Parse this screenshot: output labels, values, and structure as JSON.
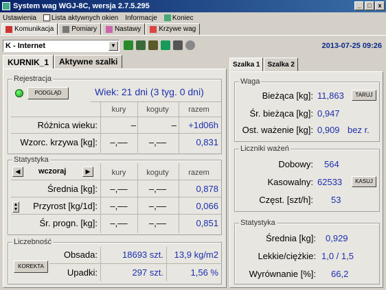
{
  "window": {
    "title": "System wag WGJ-8C, wersja 2.7.5.295",
    "min": "_",
    "max": "□",
    "close": "x"
  },
  "menu": [
    "Ustawienia",
    "Lista aktywnych okien",
    "Informacje",
    "Koniec"
  ],
  "maintabs": [
    "Komunikacja",
    "Pomiary",
    "Nastawy",
    "Krzywe wag"
  ],
  "toolbar": {
    "combo": "K - Internet",
    "datetime": "2013-07-25 09:26"
  },
  "subtabs": [
    "KURNIK_1",
    "Aktywne szalki"
  ],
  "rejestracja": {
    "label": "Rejestracja",
    "button": "PODGLĄD",
    "wiek": "Wiek:  21 dni (3 tyg. 0 dni)",
    "headers": [
      "kury",
      "koguty",
      "razem"
    ],
    "rows": [
      {
        "label": "Różnica wieku:",
        "kury": "–",
        "koguty": "–",
        "razem": "+1d06h"
      },
      {
        "label": "Wzorc. krzywa [kg]:",
        "kury": "–,––",
        "koguty": "–,––",
        "razem": "0,831"
      }
    ]
  },
  "statystyka": {
    "label": "Statystyka",
    "period": "wczoraj",
    "prev": "◀",
    "next": "▶",
    "headers": [
      "kury",
      "koguty",
      "razem"
    ],
    "rows": [
      {
        "label": "Średnia [kg]:",
        "kury": "–,––",
        "koguty": "–,––",
        "razem": "0,878"
      },
      {
        "label": "Przyrost [kg/1d]:",
        "kury": "–,––",
        "koguty": "–,––",
        "razem": "0,066"
      },
      {
        "label": "Śr. progn. [kg]:",
        "kury": "–,––",
        "koguty": "–,––",
        "razem": "0,851"
      }
    ]
  },
  "licznosc": {
    "label": "Liczebność",
    "button": "KOREKTA",
    "rows": [
      {
        "label": "Obsada:",
        "v1": "18693 szt.",
        "v2": "13,9 kg/m2"
      },
      {
        "label": "Upadki:",
        "v1": "297 szt.",
        "v2": "1,56 %"
      }
    ]
  },
  "rtabs": [
    "Szalka 1",
    "Szalka 2"
  ],
  "waga": {
    "label": "Waga",
    "tare_button": "TARUJ",
    "rows": [
      {
        "label": "Bieżąca [kg]:",
        "value": "11,863"
      },
      {
        "label": "Śr. bieżąca [kg]:",
        "value": "0,947"
      },
      {
        "label": "Ost. ważenie [kg]:",
        "value": "0,909",
        "suffix": "bez r."
      }
    ]
  },
  "liczniki": {
    "label": "Liczniki ważeń",
    "reset_button": "KASUJ",
    "rows": [
      {
        "label": "Dobowy:",
        "value": "564"
      },
      {
        "label": "Kasowalny:",
        "value": "62533"
      },
      {
        "label": "Częst. [szt/h]:",
        "value": "53"
      }
    ]
  },
  "rstat": {
    "label": "Statystyka",
    "rows": [
      {
        "label": "Średnia [kg]:",
        "value": "0,929"
      },
      {
        "label": "Lekkie/ciężkie:",
        "value": "1,0 / 1,5"
      },
      {
        "label": "Wyrównanie [%]:",
        "value": "66,2"
      }
    ]
  }
}
